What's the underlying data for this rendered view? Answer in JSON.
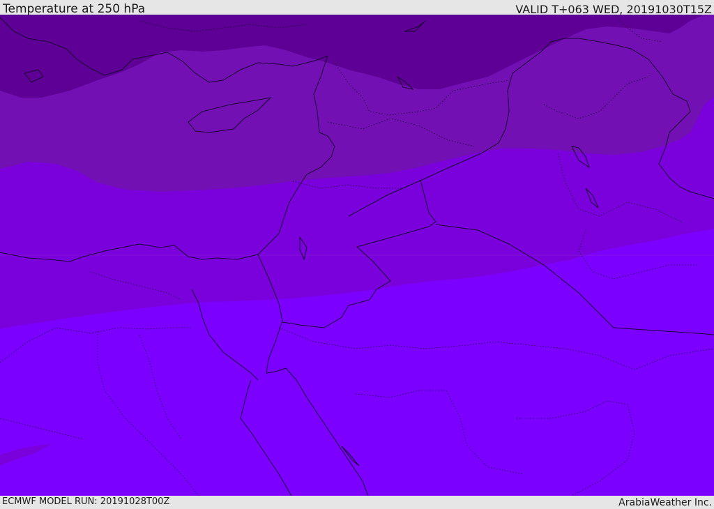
{
  "header": {
    "title": "Temperature at 250 hPa",
    "valid": "VALID T+063 WED, 20191030T15Z"
  },
  "footer": {
    "model_run": "ECMWF MODEL RUN: 20191028T00Z",
    "credit": "ArabiaWeather Inc."
  },
  "colors": {
    "band_darkest": "#5e0096",
    "band_dark": "#7210b3",
    "band_mid": "#7a00dc",
    "band_light": "#7c00ff",
    "border_line": "#1a0033",
    "frame_bg": "#e6e6e6"
  }
}
